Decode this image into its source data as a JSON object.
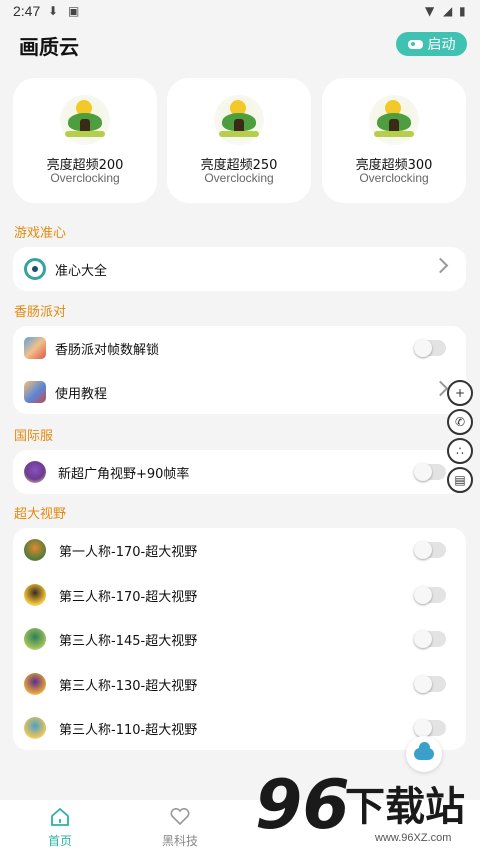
{
  "status": {
    "time": "2:47"
  },
  "header": {
    "title": "画质云",
    "start_label": "启动"
  },
  "cards": [
    {
      "title": "亮度超频200",
      "subtitle": "Overclocking"
    },
    {
      "title": "亮度超频250",
      "subtitle": "Overclocking"
    },
    {
      "title": "亮度超频300",
      "subtitle": "Overclocking"
    }
  ],
  "sections": {
    "crosshair": {
      "label": "游戏准心",
      "items": [
        {
          "label": "准心大全",
          "control": "arrow"
        }
      ]
    },
    "sausage": {
      "label": "香肠派对",
      "items": [
        {
          "label": "香肠派对帧数解锁",
          "control": "toggle",
          "on": false
        },
        {
          "label": "使用教程",
          "control": "arrow"
        }
      ]
    },
    "intl": {
      "label": "国际服",
      "items": [
        {
          "label": "新超广角视野+90帧率",
          "control": "toggle",
          "on": false
        }
      ]
    },
    "wide": {
      "label": "超大视野",
      "items": [
        {
          "label": "第一人称-170-超大视野",
          "control": "toggle",
          "on": false
        },
        {
          "label": "第三人称-170-超大视野",
          "control": "toggle",
          "on": false
        },
        {
          "label": "第三人称-145-超大视野",
          "control": "toggle",
          "on": false
        },
        {
          "label": "第三人称-130-超大视野",
          "control": "toggle",
          "on": false
        },
        {
          "label": "第三人称-110-超大视野",
          "control": "toggle",
          "on": false
        }
      ]
    }
  },
  "tabbar": {
    "home": "首页",
    "tech": "黑科技"
  },
  "watermark": {
    "number": "96",
    "text": "下载站",
    "url": "www.96XZ.com"
  },
  "colors": {
    "accent": "#3fc2b1",
    "section": "#e38a10",
    "tab_active": "#2ab3a3"
  },
  "icons": {
    "start": "gamepad-icon",
    "float": [
      "plus-shield-icon",
      "phone-icon",
      "share-icon",
      "store-icon"
    ],
    "cloud": "cloud-icon"
  }
}
